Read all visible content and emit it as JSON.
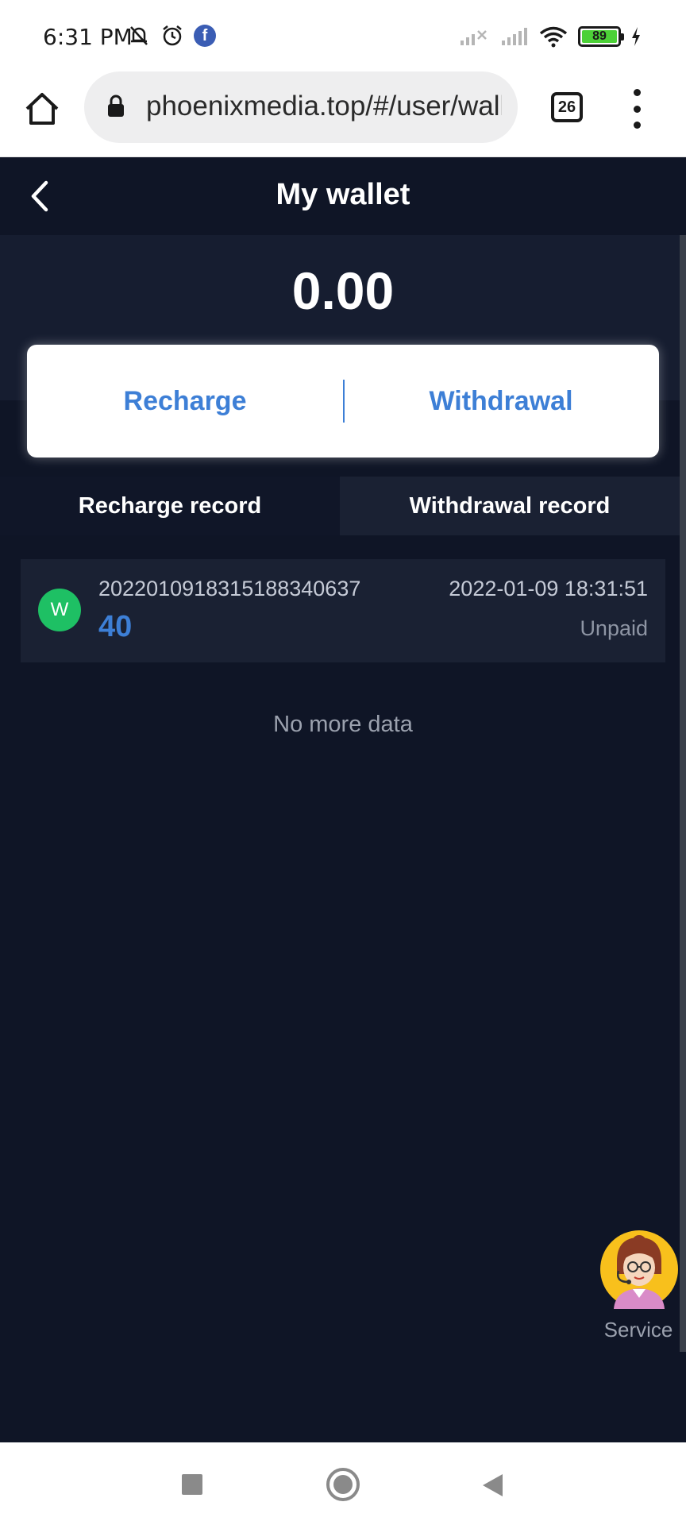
{
  "status_bar": {
    "time": "6:31 PM",
    "battery_level": "89",
    "icons": [
      "mute-bell-icon",
      "alarm-icon",
      "facebook-icon",
      "signal-x-icon",
      "signal-icon",
      "wifi-icon",
      "battery-icon",
      "charging-icon"
    ]
  },
  "browser": {
    "url": "phoenixmedia.top/#/user/wallet",
    "tab_count": "26"
  },
  "header": {
    "title": "My wallet"
  },
  "wallet": {
    "balance": "0.00",
    "recharge_label": "Recharge",
    "withdrawal_label": "Withdrawal"
  },
  "tabs": [
    {
      "label": "Recharge record",
      "active": true
    },
    {
      "label": "Withdrawal record",
      "active": false
    }
  ],
  "records": [
    {
      "avatar": "W",
      "order": "2022010918315188340637",
      "amount": "40",
      "time": "2022-01-09 18:31:51",
      "status": "Unpaid"
    }
  ],
  "no_more_text": "No more data",
  "service": {
    "label": "Service"
  },
  "colors": {
    "background": "#0f1526",
    "accent_blue": "#3d7fd6",
    "avatar_green": "#1ec064"
  }
}
